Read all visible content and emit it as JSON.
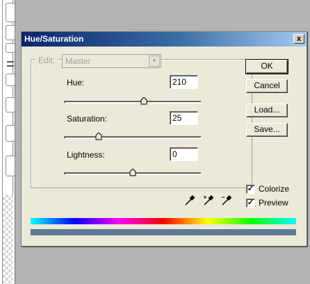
{
  "dialog": {
    "title": "Hue/Saturation",
    "close_glyph": "x"
  },
  "edit": {
    "label": "Edit:",
    "selected": "Master",
    "arrow_glyph": "▼"
  },
  "hue": {
    "label": "Hue:",
    "value": "210",
    "slider_fraction": 0.583
  },
  "saturation": {
    "label": "Saturation:",
    "value": "25",
    "slider_fraction": 0.252
  },
  "lightness": {
    "label": "Lightness:",
    "value": "0",
    "slider_fraction": 0.5
  },
  "buttons": {
    "ok": "OK",
    "cancel": "Cancel",
    "load": "Load...",
    "save": "Save..."
  },
  "colorize": {
    "label": "Colorize",
    "checked": true,
    "mark": "✓"
  },
  "preview": {
    "label": "Preview",
    "checked": true,
    "mark": "✓"
  },
  "icons": {
    "eyedropper": "eyedropper-icon",
    "eyedropper_plus": "eyedropper-plus-icon",
    "eyedropper_minus": "eyedropper-minus-icon"
  },
  "colors": {
    "titlebar_start": "#0a246a",
    "titlebar_end": "#a6caf0",
    "dialog_bg": "#ece9d8",
    "result_bar": "#5e7a94"
  }
}
